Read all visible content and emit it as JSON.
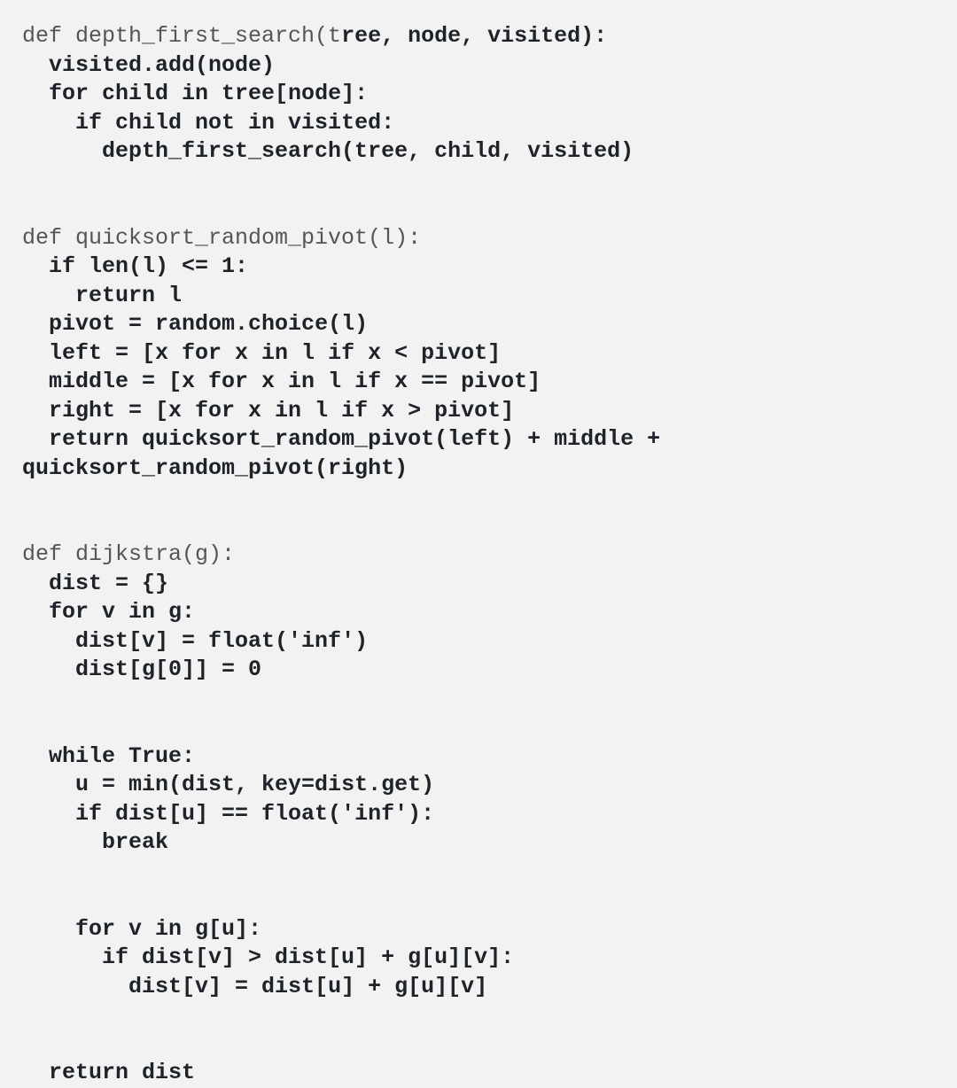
{
  "code": {
    "lines": [
      {
        "segments": [
          {
            "text": "def depth_first_search(t",
            "class": "reg"
          },
          {
            "text": "ree, node, visited):",
            "class": "bold"
          }
        ]
      },
      {
        "segments": [
          {
            "text": "  ",
            "class": "reg"
          },
          {
            "text": "visited.add(node)",
            "class": "bold"
          }
        ]
      },
      {
        "segments": [
          {
            "text": "  ",
            "class": "reg"
          },
          {
            "text": "for child in tree[node]:",
            "class": "bold"
          }
        ]
      },
      {
        "segments": [
          {
            "text": "    ",
            "class": "reg"
          },
          {
            "text": "if child not in visited:",
            "class": "bold"
          }
        ]
      },
      {
        "segments": [
          {
            "text": "      ",
            "class": "reg"
          },
          {
            "text": "depth_first_search(tree, child, visited)",
            "class": "bold"
          }
        ]
      },
      {
        "segments": [
          {
            "text": "",
            "class": "reg"
          }
        ]
      },
      {
        "segments": [
          {
            "text": "",
            "class": "reg"
          }
        ]
      },
      {
        "segments": [
          {
            "text": "def quicksort_random_pivot(l):",
            "class": "reg"
          }
        ]
      },
      {
        "segments": [
          {
            "text": "  ",
            "class": "reg"
          },
          {
            "text": "if len(l) <= 1:",
            "class": "bold"
          }
        ]
      },
      {
        "segments": [
          {
            "text": "    ",
            "class": "reg"
          },
          {
            "text": "return l",
            "class": "bold"
          }
        ]
      },
      {
        "segments": [
          {
            "text": "  ",
            "class": "reg"
          },
          {
            "text": "pivot = random.choice(l)",
            "class": "bold"
          }
        ]
      },
      {
        "segments": [
          {
            "text": "  ",
            "class": "reg"
          },
          {
            "text": "left = [x for x in l if x < pivot]",
            "class": "bold"
          }
        ]
      },
      {
        "segments": [
          {
            "text": "  ",
            "class": "reg"
          },
          {
            "text": "middle = [x for x in l if x == pivot]",
            "class": "bold"
          }
        ]
      },
      {
        "segments": [
          {
            "text": "  ",
            "class": "reg"
          },
          {
            "text": "right = [x for x in l if x > pivot]",
            "class": "bold"
          }
        ]
      },
      {
        "segments": [
          {
            "text": "  ",
            "class": "reg"
          },
          {
            "text": "return quicksort_random_pivot(left) + middle + quicksort_random_pivot(right)",
            "class": "bold"
          }
        ]
      },
      {
        "segments": [
          {
            "text": "",
            "class": "reg"
          }
        ]
      },
      {
        "segments": [
          {
            "text": "",
            "class": "reg"
          }
        ]
      },
      {
        "segments": [
          {
            "text": "def dijkstra(g):",
            "class": "reg"
          }
        ]
      },
      {
        "segments": [
          {
            "text": "  ",
            "class": "reg"
          },
          {
            "text": "dist = {}",
            "class": "bold"
          }
        ]
      },
      {
        "segments": [
          {
            "text": "  ",
            "class": "reg"
          },
          {
            "text": "for v in g:",
            "class": "bold"
          }
        ]
      },
      {
        "segments": [
          {
            "text": "    ",
            "class": "reg"
          },
          {
            "text": "dist[v] = float('inf')",
            "class": "bold"
          }
        ]
      },
      {
        "segments": [
          {
            "text": "    ",
            "class": "reg"
          },
          {
            "text": "dist[g[0]] = 0",
            "class": "bold"
          }
        ]
      },
      {
        "segments": [
          {
            "text": "",
            "class": "reg"
          }
        ]
      },
      {
        "segments": [
          {
            "text": "",
            "class": "reg"
          }
        ]
      },
      {
        "segments": [
          {
            "text": "  ",
            "class": "reg"
          },
          {
            "text": "while True:",
            "class": "bold"
          }
        ]
      },
      {
        "segments": [
          {
            "text": "    ",
            "class": "reg"
          },
          {
            "text": "u = min(dist, key=dist.get)",
            "class": "bold"
          }
        ]
      },
      {
        "segments": [
          {
            "text": "    ",
            "class": "reg"
          },
          {
            "text": "if dist[u] == float('inf'):",
            "class": "bold"
          }
        ]
      },
      {
        "segments": [
          {
            "text": "      ",
            "class": "reg"
          },
          {
            "text": "break",
            "class": "bold"
          }
        ]
      },
      {
        "segments": [
          {
            "text": "",
            "class": "reg"
          }
        ]
      },
      {
        "segments": [
          {
            "text": "",
            "class": "reg"
          }
        ]
      },
      {
        "segments": [
          {
            "text": "    ",
            "class": "reg"
          },
          {
            "text": "for v in g[u]:",
            "class": "bold"
          }
        ]
      },
      {
        "segments": [
          {
            "text": "      ",
            "class": "reg"
          },
          {
            "text": "if dist[v] > dist[u] + g[u][v]:",
            "class": "bold"
          }
        ]
      },
      {
        "segments": [
          {
            "text": "        ",
            "class": "reg"
          },
          {
            "text": "dist[v] = dist[u] + g[u][v]",
            "class": "bold"
          }
        ]
      },
      {
        "segments": [
          {
            "text": "",
            "class": "reg"
          }
        ]
      },
      {
        "segments": [
          {
            "text": "",
            "class": "reg"
          }
        ]
      },
      {
        "segments": [
          {
            "text": "  ",
            "class": "reg"
          },
          {
            "text": "return dist",
            "class": "bold"
          }
        ]
      }
    ]
  }
}
